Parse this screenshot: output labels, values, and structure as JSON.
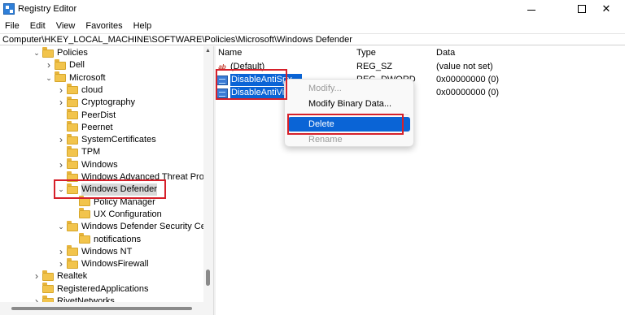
{
  "window": {
    "title": "Registry Editor",
    "minimize_glyph": "—",
    "close_glyph": "✕"
  },
  "menu": [
    "File",
    "Edit",
    "View",
    "Favorites",
    "Help"
  ],
  "address": "Computer\\HKEY_LOCAL_MACHINE\\SOFTWARE\\Policies\\Microsoft\\Windows Defender",
  "tree": [
    {
      "label": "Policies",
      "depth": 3,
      "chevron": "expanded"
    },
    {
      "label": "Dell",
      "depth": 4,
      "chevron": "collapsed"
    },
    {
      "label": "Microsoft",
      "depth": 4,
      "chevron": "expanded"
    },
    {
      "label": "cloud",
      "depth": 5,
      "chevron": "collapsed"
    },
    {
      "label": "Cryptography",
      "depth": 5,
      "chevron": "collapsed"
    },
    {
      "label": "PeerDist",
      "depth": 5,
      "chevron": "none"
    },
    {
      "label": "Peernet",
      "depth": 5,
      "chevron": "none"
    },
    {
      "label": "SystemCertificates",
      "depth": 5,
      "chevron": "collapsed"
    },
    {
      "label": "TPM",
      "depth": 5,
      "chevron": "none"
    },
    {
      "label": "Windows",
      "depth": 5,
      "chevron": "collapsed"
    },
    {
      "label": "Windows Advanced Threat Protecti",
      "depth": 5,
      "chevron": "none"
    },
    {
      "label": "Windows Defender",
      "depth": 5,
      "chevron": "expanded",
      "selected": true
    },
    {
      "label": "Policy Manager",
      "depth": 6,
      "chevron": "none"
    },
    {
      "label": "UX Configuration",
      "depth": 6,
      "chevron": "none"
    },
    {
      "label": "Windows Defender Security Center",
      "depth": 5,
      "chevron": "expanded"
    },
    {
      "label": "notifications",
      "depth": 6,
      "chevron": "none"
    },
    {
      "label": "Windows NT",
      "depth": 5,
      "chevron": "collapsed"
    },
    {
      "label": "WindowsFirewall",
      "depth": 5,
      "chevron": "collapsed"
    },
    {
      "label": "Realtek",
      "depth": 3,
      "chevron": "collapsed"
    },
    {
      "label": "RegisteredApplications",
      "depth": 3,
      "chevron": "none"
    },
    {
      "label": "RivetNetworks",
      "depth": 3,
      "chevron": "collapsed"
    }
  ],
  "columns": {
    "name": "Name",
    "type": "Type",
    "data": "Data"
  },
  "values": [
    {
      "name": "(Default)",
      "type": "REG_SZ",
      "data": "(value not set)",
      "icon": "string-value-icon"
    },
    {
      "name": "DisableAntiSpy",
      "type": "REG_DWORD",
      "data": "0x00000000 (0)",
      "icon": "dword-value-icon",
      "selected": true
    },
    {
      "name": "DisableAntiViru",
      "type": "",
      "data": "0x00000000 (0)",
      "icon": "dword-value-icon",
      "selected": true
    }
  ],
  "context_menu": {
    "modify": "Modify...",
    "modify_binary": "Modify Binary Data...",
    "delete": "Delete",
    "rename": "Rename"
  },
  "highlight_color": "#d6202a",
  "selection_color": "#0a64d6"
}
